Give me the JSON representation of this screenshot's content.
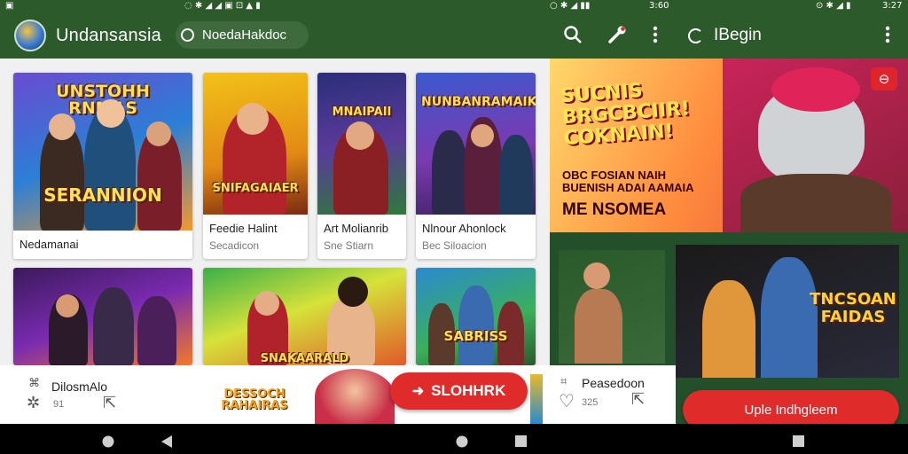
{
  "status_bar": {
    "left_time": "3:60",
    "right_time": "3:27"
  },
  "app_bar": {
    "app_name": "Undansansia",
    "chip_label": "NoedaHakdoc",
    "search_icon": "search-icon",
    "mic_icon": "mic-icon",
    "more_icon": "more-vert-icon",
    "begin_label": "IBegin"
  },
  "grid": {
    "cards": [
      {
        "art_title": "UNSTOHH RNMAS",
        "art_subtitle": "SERANNION",
        "label": "Nedamanai",
        "sub": ""
      },
      {
        "art_title": "SNIFAGAIAER",
        "art_subtitle": "",
        "label": "Feedie Halint",
        "sub": "Secadicon"
      },
      {
        "art_title": "MNAIPAII",
        "art_subtitle": "",
        "label": "Art Molianrib",
        "sub": "Sne Stiarn"
      },
      {
        "art_title": "NUNBANRAMAIK",
        "art_subtitle": "",
        "label": "Nlnour Ahonlock",
        "sub": "Bec Siloacion"
      },
      {
        "art_title": "",
        "art_subtitle": "",
        "label": "",
        "sub": ""
      },
      {
        "art_title": "SNAKAARALD",
        "art_subtitle": "",
        "label": "",
        "sub": ""
      },
      {
        "art_title": "SABRISS",
        "art_subtitle": "",
        "label": "",
        "sub": ""
      }
    ]
  },
  "promo": {
    "headline": "SUCNIS BRGCBCIIR! COKNAIN!",
    "subline": "OBC FOSIAN NAIH BUENISH ADAI AAMAIA",
    "tag": "ME NSOMEA"
  },
  "feature_card": {
    "art_title": "TNCSOAN FAIDAS"
  },
  "bottom": {
    "left_title": "DilosmAlo",
    "left_sub": "91",
    "logo_text": "DESSOCH RAHAIRAS",
    "cta_center": "SLOHHRK",
    "right_title": "Peasedoon",
    "right_sub": "325",
    "cta_right": "Uple Indhgleem"
  },
  "colors": {
    "brand_green": "#2d5a2b",
    "accent_red": "#e02b2b"
  }
}
